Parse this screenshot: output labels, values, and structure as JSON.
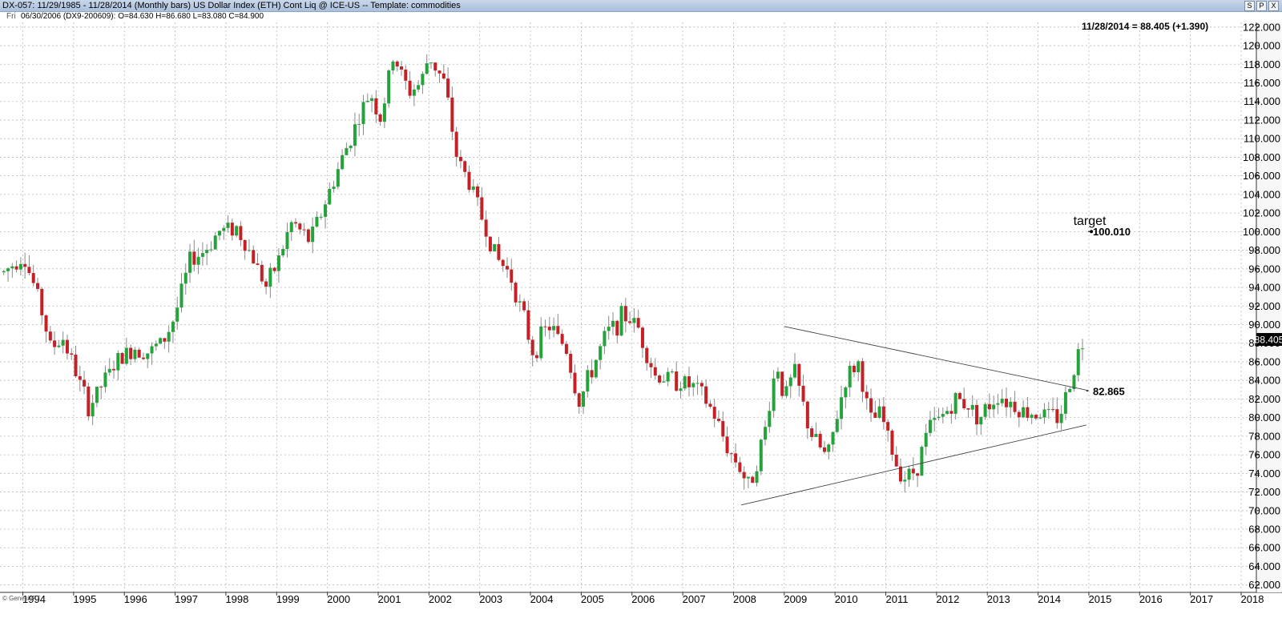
{
  "window": {
    "title": "DX-057:  11/29/1985 - 11/28/2014  (Monthly bars)   US Dollar Index (ETH) Cont Liq @ ICE-US   --  Template: commodities",
    "buttons": [
      "S",
      "P",
      "X"
    ]
  },
  "info_bar": {
    "day": "Fri",
    "ohlc": "06/30/2006 (DX9-200609):  O=84.630  H=86.680  L=83.080  C=84.900"
  },
  "credit": "© GenesisFT",
  "colors": {
    "up": "#23a33a",
    "down": "#c42025",
    "grid": "#b8b8b8",
    "line": "#444444"
  },
  "chart_data": {
    "type": "candlestick",
    "last_label": "11/28/2014 = 88.405 (+1.390)",
    "last_value_box": "88.405",
    "xlim": [
      1993.55,
      2018.3
    ],
    "ylim": [
      61.2,
      122.5
    ],
    "x_ticks": [
      "1994",
      "1995",
      "1996",
      "1997",
      "1998",
      "1999",
      "2000",
      "2001",
      "2002",
      "2003",
      "2004",
      "2005",
      "2006",
      "2007",
      "2008",
      "2009",
      "2010",
      "2011",
      "2012",
      "2013",
      "2014",
      "2015",
      "2016",
      "2017",
      "2018"
    ],
    "y_ticks": [
      62,
      64,
      66,
      68,
      70,
      72,
      74,
      76,
      78,
      80,
      82,
      84,
      86,
      88,
      90,
      92,
      94,
      96,
      98,
      100,
      102,
      104,
      106,
      108,
      110,
      112,
      114,
      116,
      118,
      120,
      122
    ],
    "close_anchors": [
      [
        1993.6,
        95.5
      ],
      [
        1994.0,
        97.5
      ],
      [
        1994.3,
        93.0
      ],
      [
        1994.55,
        87.5
      ],
      [
        1994.8,
        88.5
      ],
      [
        1995.0,
        85.5
      ],
      [
        1995.3,
        81.0
      ],
      [
        1995.55,
        83.5
      ],
      [
        1995.85,
        86.0
      ],
      [
        1996.2,
        87.5
      ],
      [
        1996.5,
        87.0
      ],
      [
        1996.8,
        88.5
      ],
      [
        1997.0,
        91.0
      ],
      [
        1997.3,
        97.0
      ],
      [
        1997.6,
        98.0
      ],
      [
        1997.85,
        100.0
      ],
      [
        1998.2,
        100.5
      ],
      [
        1998.55,
        97.0
      ],
      [
        1998.8,
        94.0
      ],
      [
        1999.0,
        96.5
      ],
      [
        1999.3,
        101.0
      ],
      [
        1999.65,
        99.0
      ],
      [
        1999.95,
        103.0
      ],
      [
        2000.3,
        108.0
      ],
      [
        2000.6,
        112.0
      ],
      [
        2000.85,
        115.0
      ],
      [
        2001.05,
        112.0
      ],
      [
        2001.3,
        119.0
      ],
      [
        2001.6,
        115.0
      ],
      [
        2001.85,
        116.0
      ],
      [
        2002.0,
        119.0
      ],
      [
        2002.3,
        116.0
      ],
      [
        2002.55,
        108.0
      ],
      [
        2002.9,
        104.0
      ],
      [
        2003.1,
        100.5
      ],
      [
        2003.35,
        97.0
      ],
      [
        2003.6,
        95.5
      ],
      [
        2003.9,
        90.0
      ],
      [
        2004.05,
        87.0
      ],
      [
        2004.35,
        90.0
      ],
      [
        2004.7,
        87.5
      ],
      [
        2004.95,
        81.5
      ],
      [
        2005.2,
        85.0
      ],
      [
        2005.5,
        89.0
      ],
      [
        2005.85,
        91.0
      ],
      [
        2006.1,
        90.0
      ],
      [
        2006.45,
        84.5
      ],
      [
        2006.9,
        84.0
      ],
      [
        2007.3,
        83.0
      ],
      [
        2007.6,
        80.5
      ],
      [
        2007.9,
        76.5
      ],
      [
        2008.1,
        75.0
      ],
      [
        2008.3,
        72.5
      ],
      [
        2008.6,
        78.0
      ],
      [
        2008.85,
        86.0
      ],
      [
        2009.0,
        82.0
      ],
      [
        2009.2,
        85.0
      ],
      [
        2009.5,
        78.5
      ],
      [
        2009.85,
        75.5
      ],
      [
        2009.95,
        78.0
      ],
      [
        2010.2,
        84.0
      ],
      [
        2010.45,
        86.0
      ],
      [
        2010.7,
        79.5
      ],
      [
        2010.9,
        80.5
      ],
      [
        2011.2,
        75.0
      ],
      [
        2011.4,
        73.5
      ],
      [
        2011.6,
        74.5
      ],
      [
        2011.85,
        79.0
      ],
      [
        2012.0,
        79.5
      ],
      [
        2012.4,
        82.0
      ],
      [
        2012.6,
        81.5
      ],
      [
        2012.85,
        80.0
      ],
      [
        2013.2,
        82.5
      ],
      [
        2013.5,
        81.5
      ],
      [
        2013.75,
        80.5
      ],
      [
        2014.0,
        80.5
      ],
      [
        2014.4,
        80.0
      ],
      [
        2014.6,
        83.0
      ],
      [
        2014.75,
        86.5
      ],
      [
        2014.92,
        88.4
      ]
    ],
    "annotations": [
      {
        "text": "target",
        "value": 100.01,
        "value_label": "100.010",
        "start_x": 2015.05
      },
      {
        "text": "",
        "value": 82.865,
        "value_label": "82.865",
        "start_x": 2014.95
      }
    ],
    "trendlines": [
      {
        "from": [
          2009.0,
          89.8
        ],
        "to": [
          2015.0,
          82.9
        ]
      },
      {
        "from": [
          2008.15,
          70.6
        ],
        "to": [
          2014.95,
          79.2
        ]
      }
    ]
  }
}
